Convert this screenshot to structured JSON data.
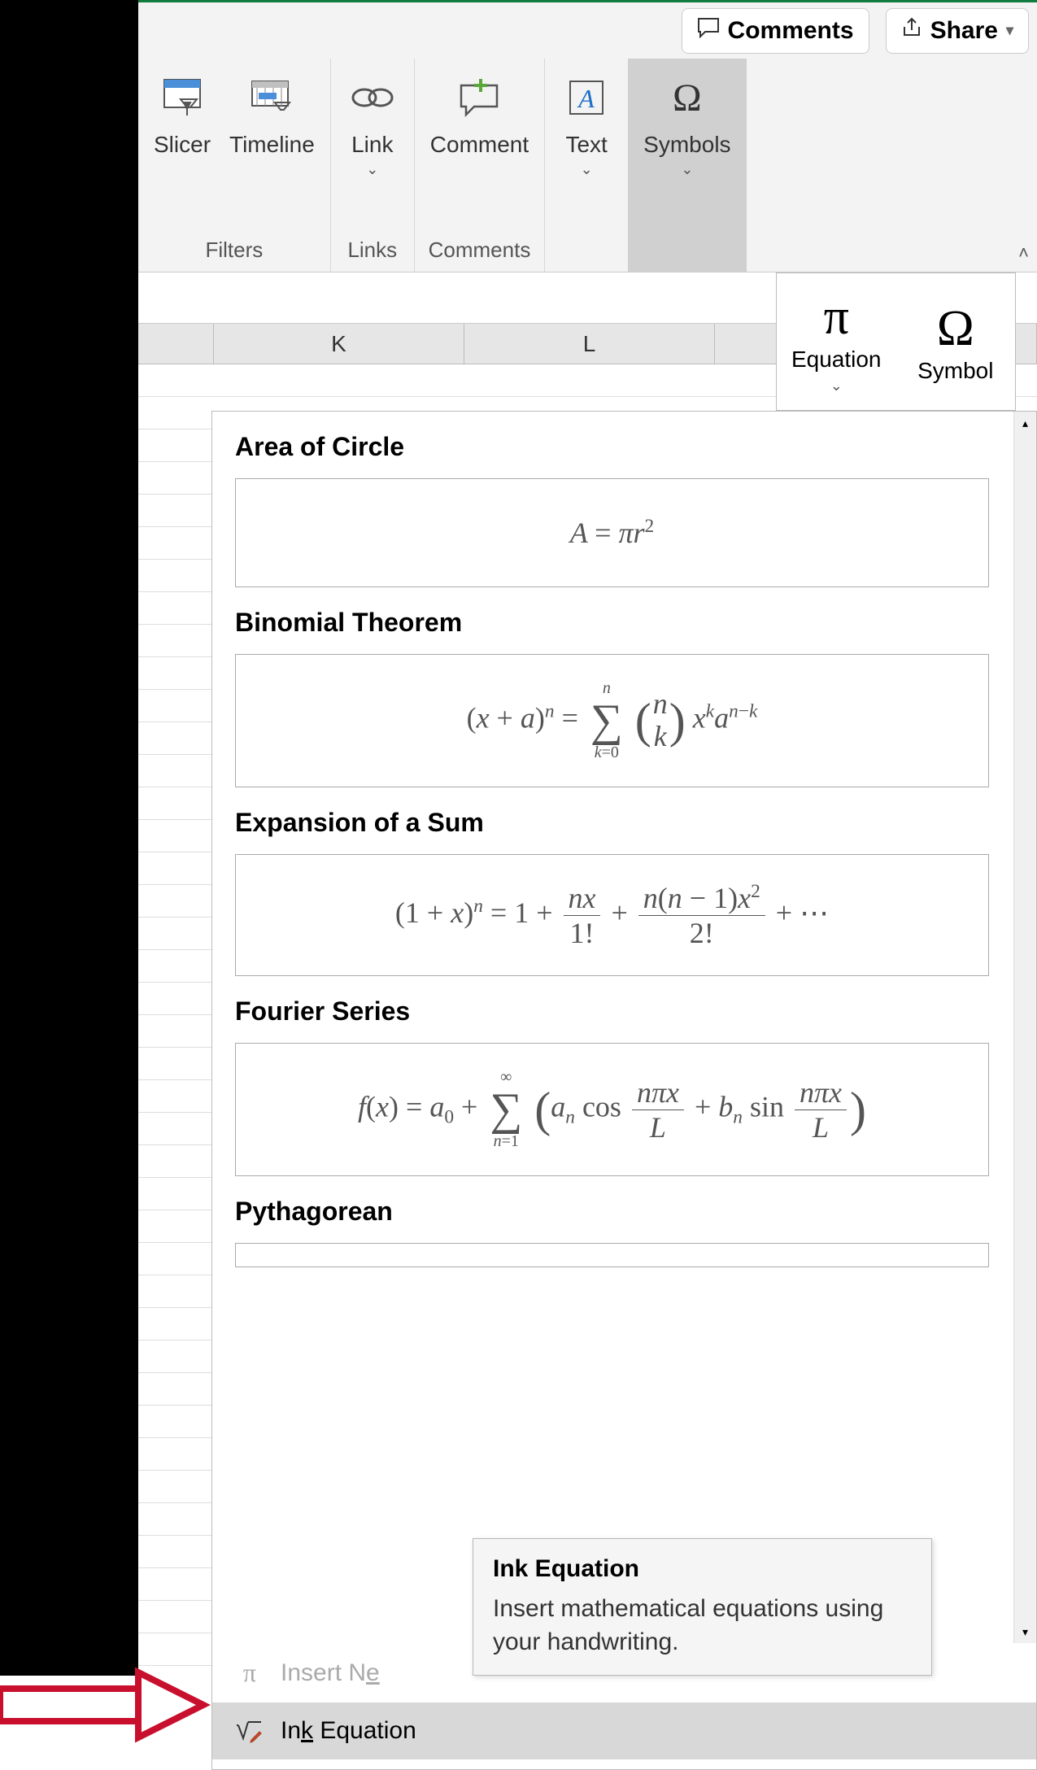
{
  "titlebar": {
    "comments_label": "Comments",
    "share_label": "Share"
  },
  "ribbon": {
    "filters": {
      "group_label": "Filters",
      "slicer_label": "Slicer",
      "timeline_label": "Timeline"
    },
    "links": {
      "group_label": "Links",
      "link_label": "Link"
    },
    "comments": {
      "group_label": "Comments",
      "comment_label": "Comment"
    },
    "text": {
      "label": "Text"
    },
    "symbols": {
      "label": "Symbols"
    }
  },
  "symbols_dropdown": {
    "equation_label": "Equation",
    "symbol_label": "Symbol"
  },
  "columns": {
    "k": "K",
    "l": "L"
  },
  "equation_gallery": {
    "items": [
      {
        "title": "Area of Circle"
      },
      {
        "title": "Binomial Theorem"
      },
      {
        "title": "Expansion of a Sum"
      },
      {
        "title": "Fourier Series"
      },
      {
        "title": "Pythagorean"
      }
    ],
    "insert_new_label_prefix": "Insert N",
    "insert_new_underline": "e",
    "ink_equation_label_prefix": "In",
    "ink_equation_underline": "k",
    "ink_equation_label_suffix": " Equation"
  },
  "tooltip": {
    "title": "Ink Equation",
    "body": "Insert mathematical equations using your handwriting."
  }
}
